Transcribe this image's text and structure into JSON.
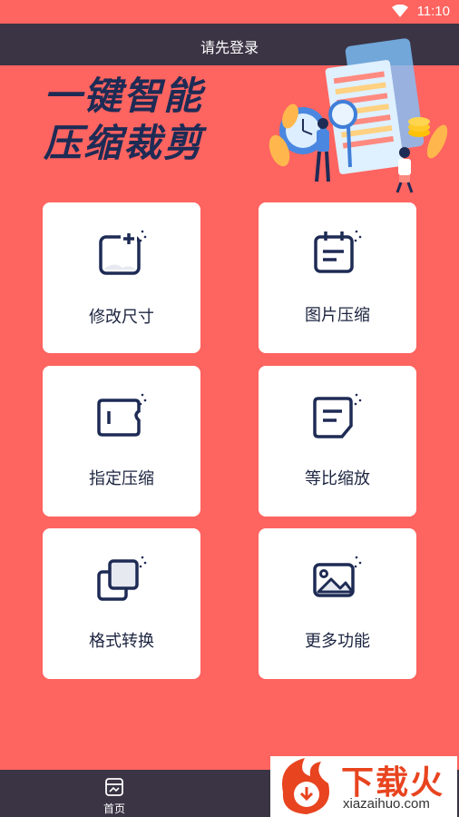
{
  "status_bar": {
    "time": "11:10"
  },
  "header": {
    "title": "请先登录"
  },
  "banner": {
    "headline_line1": "一键智能",
    "headline_line2": "压缩裁剪"
  },
  "features": [
    {
      "label": "修改尺寸",
      "icon": "resize-icon"
    },
    {
      "label": "图片压缩",
      "icon": "calendar-note-icon"
    },
    {
      "label": "指定压缩",
      "icon": "ticket-compress-icon"
    },
    {
      "label": "等比缩放",
      "icon": "document-icon"
    },
    {
      "label": "格式转换",
      "icon": "copy-layers-icon"
    },
    {
      "label": "更多功能",
      "icon": "image-icon"
    }
  ],
  "tabbar": {
    "home_label": "首页"
  },
  "watermark": {
    "text": "下载火",
    "url": "xiazaihuo.com"
  },
  "colors": {
    "background": "#fe6460",
    "header": "#3a3444",
    "card": "#ffffff",
    "icon": "#1e2b55"
  }
}
